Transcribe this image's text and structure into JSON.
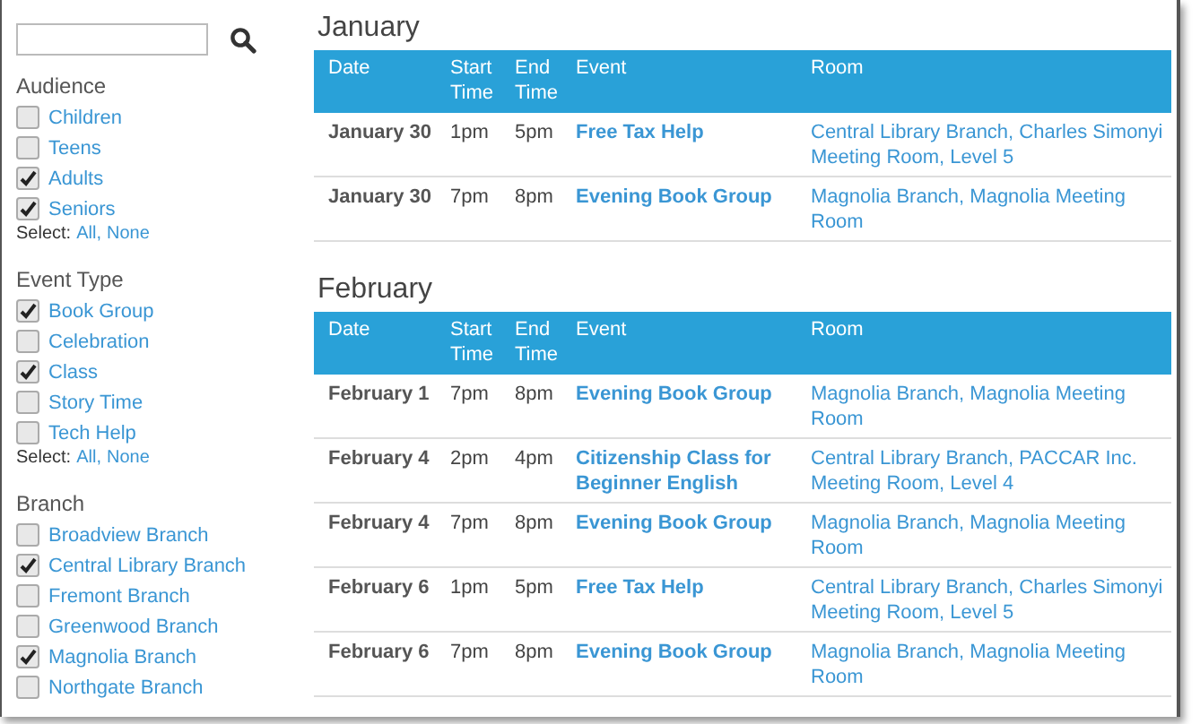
{
  "filters": [
    {
      "title": "Audience",
      "items": [
        {
          "label": "Children",
          "checked": false
        },
        {
          "label": "Teens",
          "checked": false
        },
        {
          "label": "Adults",
          "checked": true
        },
        {
          "label": "Seniors",
          "checked": true
        }
      ],
      "select": {
        "label": "Select:",
        "all": "All,",
        "none": "None"
      }
    },
    {
      "title": "Event Type",
      "items": [
        {
          "label": "Book Group",
          "checked": true
        },
        {
          "label": "Celebration",
          "checked": false
        },
        {
          "label": "Class",
          "checked": true
        },
        {
          "label": "Story Time",
          "checked": false
        },
        {
          "label": "Tech Help",
          "checked": false
        }
      ],
      "select": {
        "label": "Select:",
        "all": "All,",
        "none": "None"
      }
    },
    {
      "title": "Branch",
      "items": [
        {
          "label": "Broadview Branch",
          "checked": false
        },
        {
          "label": "Central Library Branch",
          "checked": true
        },
        {
          "label": "Fremont Branch",
          "checked": false
        },
        {
          "label": "Greenwood Branch",
          "checked": false
        },
        {
          "label": "Magnolia Branch",
          "checked": true
        },
        {
          "label": "Northgate Branch",
          "checked": false
        }
      ]
    }
  ],
  "months": [
    {
      "title": "January",
      "columns": [
        "Date",
        "Start Time",
        "End Time",
        "Event",
        "Room"
      ],
      "rows": [
        {
          "date": "January 30",
          "start": "1pm",
          "end": "5pm",
          "event": "Free Tax Help",
          "room": "Central Library Branch, Charles Simonyi Meeting Room, Level 5"
        },
        {
          "date": "January 30",
          "start": "7pm",
          "end": "8pm",
          "event": "Evening Book Group",
          "room": "Magnolia Branch, Magnolia Meeting Room"
        }
      ]
    },
    {
      "title": "February",
      "columns": [
        "Date",
        "Start Time",
        "End Time",
        "Event",
        "Room"
      ],
      "rows": [
        {
          "date": "February 1",
          "start": "7pm",
          "end": "8pm",
          "event": "Evening Book Group",
          "room": "Magnolia Branch, Magnolia Meeting Room"
        },
        {
          "date": "February 4",
          "start": "2pm",
          "end": "4pm",
          "event": "Citizenship Class for Beginner English",
          "room": "Central Library Branch, PACCAR Inc. Meeting Room, Level 4"
        },
        {
          "date": "February 4",
          "start": "7pm",
          "end": "8pm",
          "event": "Evening Book Group",
          "room": "Magnolia Branch, Magnolia Meeting Room"
        },
        {
          "date": "February 6",
          "start": "1pm",
          "end": "5pm",
          "event": "Free Tax Help",
          "room": "Central Library Branch, Charles Simonyi Meeting Room, Level 5"
        },
        {
          "date": "February 6",
          "start": "7pm",
          "end": "8pm",
          "event": "Evening Book Group",
          "room": "Magnolia Branch, Magnolia Meeting Room"
        }
      ]
    }
  ]
}
